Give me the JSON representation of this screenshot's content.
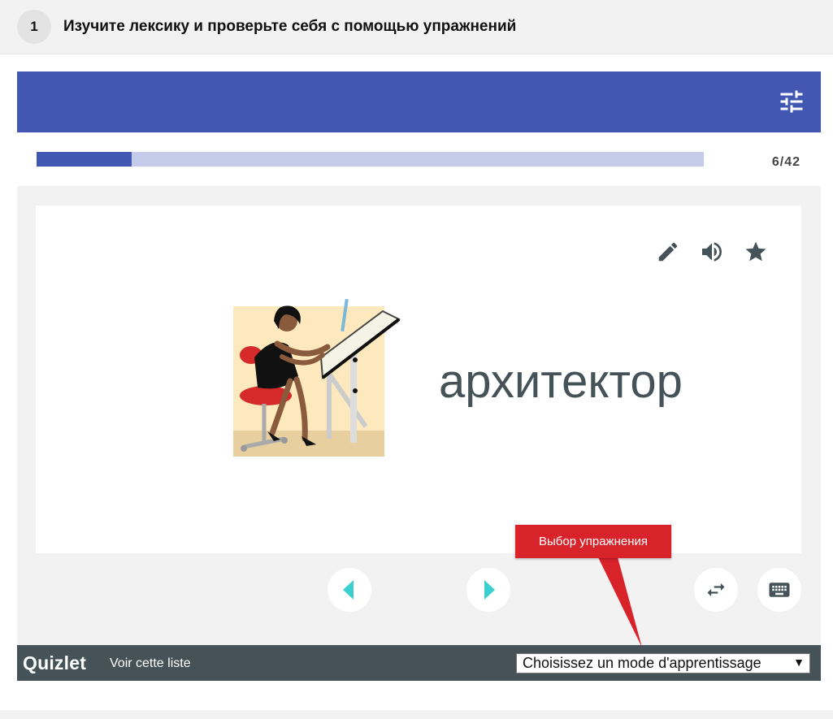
{
  "step": {
    "number": "1",
    "title": "Изучите лексику и проверьте себя с помощью упражнений"
  },
  "colors": {
    "brand_blue": "#4257b2",
    "progress_track": "#c4cbea",
    "arrow_teal": "#3ccfcf",
    "footer_gray": "#455358",
    "callout_red": "#d9232a"
  },
  "progress": {
    "current": 6,
    "total": 42,
    "label": "6/42"
  },
  "card": {
    "term": "архитектор",
    "image": "architect-woman-at-drafting-table-illustration",
    "icons": [
      "pencil-icon",
      "volume-icon",
      "star-icon"
    ]
  },
  "controls": {
    "prev": "chevron-left-icon",
    "next": "chevron-right-icon",
    "swap": "swap-arrows-icon",
    "keyboard": "keyboard-icon"
  },
  "footer": {
    "logo": "Quizlet",
    "link": "Voir cette liste",
    "mode_select": "Choisissez un mode d'apprentissage"
  },
  "callout": {
    "text": "Выбор упражнения"
  }
}
